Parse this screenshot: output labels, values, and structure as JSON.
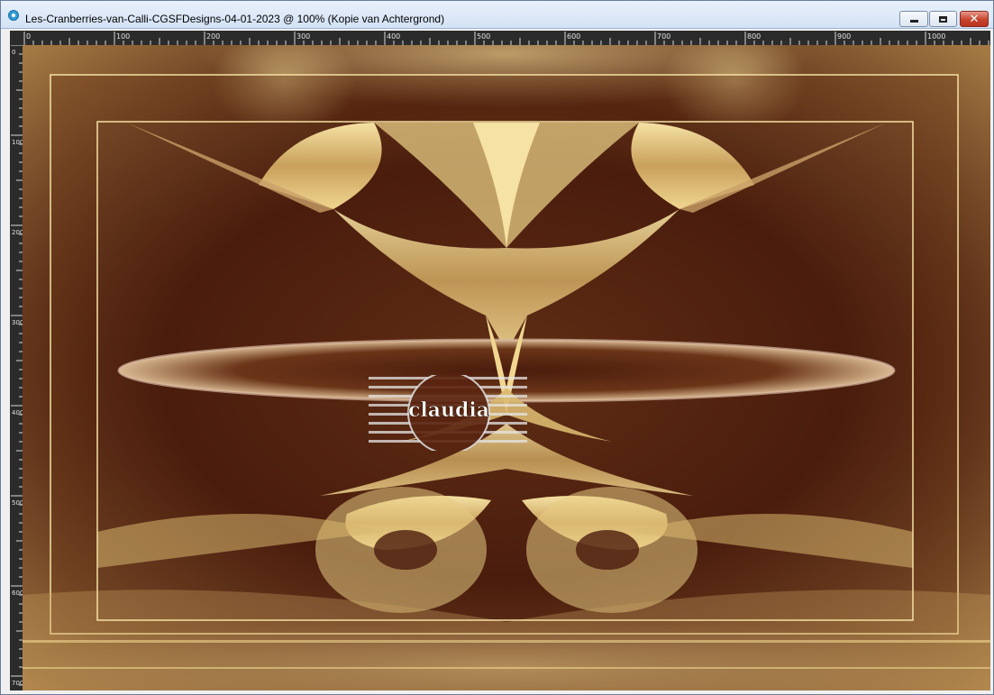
{
  "window": {
    "title": "Les-Cranberries-van-Calli-CGSFDesigns-04-01-2023 @ 100% (Kopie van Achtergrond)",
    "icon": "app-icon",
    "buttons": {
      "minimize_icon": "minimize-icon",
      "maximize_icon": "maximize-icon",
      "close_icon": "close-icon"
    }
  },
  "ruler": {
    "horizontal_labels": [
      "0",
      "100",
      "200",
      "300",
      "400",
      "500",
      "600",
      "700",
      "800",
      "900",
      "1000"
    ],
    "vertical_labels": [
      "0",
      "100",
      "200",
      "300",
      "400",
      "500",
      "600",
      "700"
    ]
  },
  "canvas": {
    "watermark_text": "claudia",
    "colors": {
      "dark": "#4a1c0c",
      "mid": "#8a5a2e",
      "gold": "#e8cc84",
      "light": "#f5e2a4"
    }
  }
}
